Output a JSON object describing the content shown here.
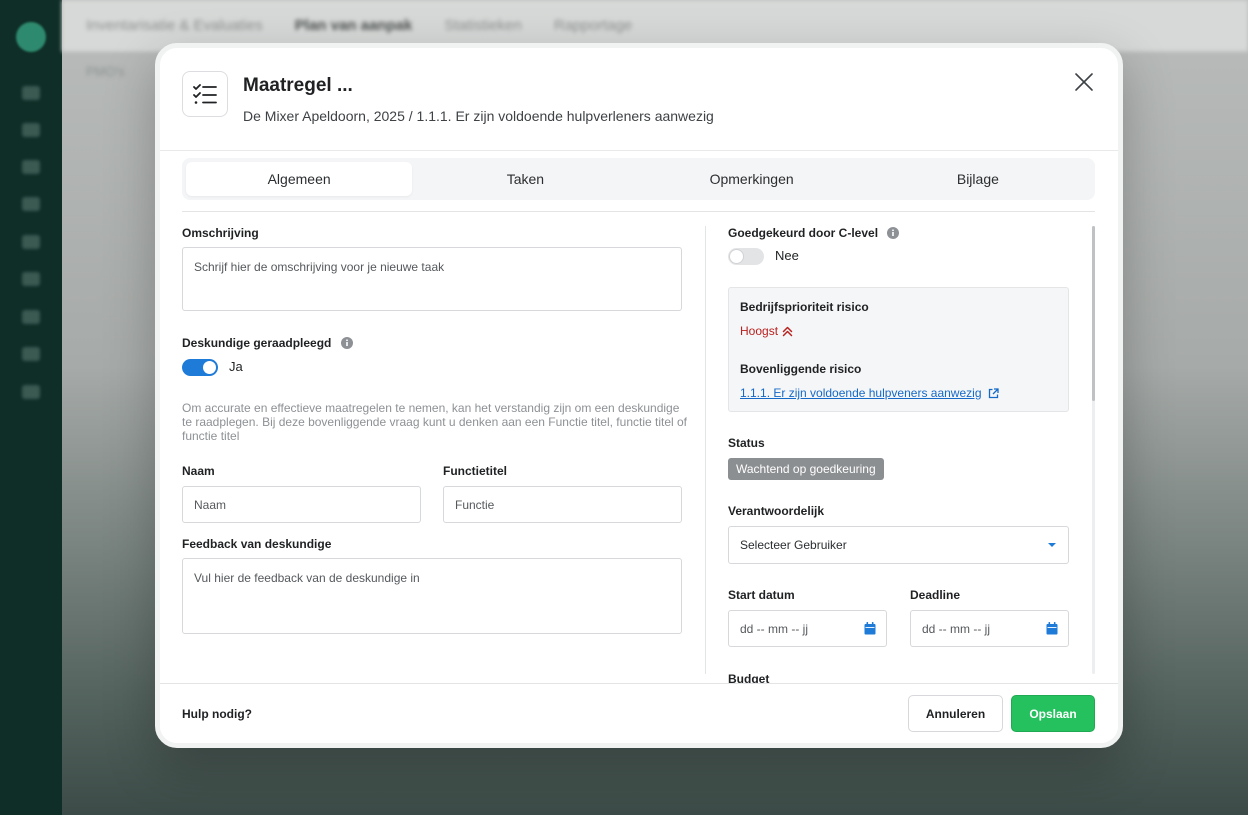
{
  "background": {
    "tabs": [
      "Inventarisatie & Evaluaties",
      "Plan van aanpak",
      "Statistieken",
      "Rapportage"
    ],
    "active_tab": "Plan van aanpak",
    "breadcrumb": "PMO's"
  },
  "modal": {
    "title": "Maatregel ...",
    "subtitle": "De Mixer Apeldoorn, 2025 / 1.1.1. Er zijn voldoende hulpverleners aanwezig",
    "icon": "checklist-icon"
  },
  "tabs": [
    {
      "label": "Algemeen",
      "active": true
    },
    {
      "label": "Taken",
      "active": false
    },
    {
      "label": "Opmerkingen",
      "active": false
    },
    {
      "label": "Bijlage",
      "active": false
    }
  ],
  "left": {
    "description_label": "Omschrijving",
    "description_placeholder": "Schrijf hier de omschrijving voor je nieuwe taak",
    "expert_label": "Deskundige geraadpleegd",
    "expert_toggle": {
      "on": true,
      "label": "Ja"
    },
    "expert_help": "Om accurate en effectieve maatregelen te nemen, kan het verstandig zijn om een deskundige te raadplegen. Bij deze bovenliggende vraag kunt u denken aan een Functie titel, functie titel of functie titel",
    "name_label": "Naam",
    "name_placeholder": "Naam",
    "function_label": "Functietitel",
    "function_placeholder": "Functie",
    "feedback_label": "Feedback van deskundige",
    "feedback_placeholder": "Vul hier de feedback van de deskundige in"
  },
  "right": {
    "approved_label": "Goedgekeurd door C-level",
    "approved_toggle": {
      "on": false,
      "label": "Nee"
    },
    "risk_priority_label": "Bedrijfsprioriteit risico",
    "risk_priority_value": "Hoogst",
    "parent_risk_label": "Bovenliggende risico",
    "parent_risk_link": "1.1.1. Er zijn voldoende hulpveners aanwezig",
    "status_label": "Status",
    "status_value": "Wachtend op goedkeuring",
    "responsible_label": "Verantwoordelijk",
    "responsible_placeholder": "Selecteer Gebruiker",
    "start_label": "Start datum",
    "start_placeholder": "dd -- mm -- jj",
    "deadline_label": "Deadline",
    "deadline_placeholder": "dd -- mm -- jj",
    "budget_label": "Budget"
  },
  "footer": {
    "help": "Hulp nodig?",
    "cancel": "Annuleren",
    "save": "Opslaan"
  },
  "colors": {
    "accent_blue": "#1e7bd8",
    "save_green": "#25c15f",
    "priority_red": "#b9211f",
    "status_gray": "#8c8f92"
  }
}
